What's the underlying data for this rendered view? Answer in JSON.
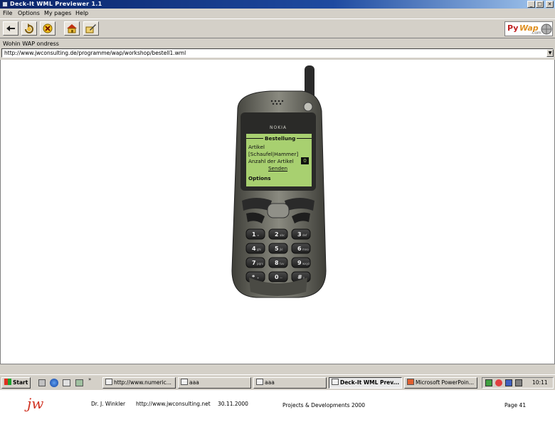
{
  "window": {
    "title": "Deck-It WML Previewer 1.1",
    "caption_buttons": [
      "_",
      "□",
      "✕"
    ]
  },
  "menu": [
    "File",
    "Options",
    "My pages",
    "Help"
  ],
  "toolbar": {
    "buttons": [
      {
        "name": "back-button",
        "icon": "back-arrow-icon"
      },
      {
        "name": "reload-button",
        "icon": "reload-icon"
      },
      {
        "name": "stop-button",
        "icon": "stop-icon"
      },
      {
        "name": "home-button",
        "icon": "home-icon"
      },
      {
        "name": "bookmark-button",
        "icon": "edit-bookmark-icon"
      }
    ],
    "logo": {
      "py": "Py",
      "wap": "Wap",
      "com": ".com"
    }
  },
  "address": {
    "label": "Wohin WAP ondress",
    "value": "http://www.jwconsulting.de/programme/wap/workshop/bestell1.wml"
  },
  "phone": {
    "brand": "NOKIA",
    "screen": {
      "title": "Bestellung",
      "lines": [
        "Artikel",
        "[Schaufel|Hammer]",
        "Anzahl der Artikel"
      ],
      "input_value": "0",
      "link": "Senden",
      "softkey": "Options"
    },
    "keys": [
      [
        "1",
        "2",
        "3"
      ],
      [
        "4",
        "5",
        "6"
      ],
      [
        "7",
        "8",
        "9"
      ],
      [
        "*",
        "0",
        "#"
      ]
    ],
    "key_sub": [
      [
        "∞",
        "abc",
        "def"
      ],
      [
        "ghi",
        "jkl",
        "mno"
      ],
      [
        "pqrs",
        "tuv",
        "wxyz"
      ],
      [
        "+",
        "—",
        "⇧"
      ]
    ]
  },
  "taskbar": {
    "start": "Start",
    "tasks": [
      {
        "label": "http://www.numeric...",
        "active": false
      },
      {
        "label": "aaa",
        "active": false
      },
      {
        "label": "aaa",
        "active": false
      },
      {
        "label": "Deck-It WML Prev...",
        "active": true
      },
      {
        "label": "Microsoft PowerPoin...",
        "active": false
      }
    ],
    "clock": "10:11"
  },
  "footer": {
    "logo": "jw",
    "author": "Dr. J. Winkler",
    "url": "http://www.jwconsulting.net",
    "date": "30.11.2000",
    "section": "Projects & Developments 2000",
    "page": "Page 41"
  },
  "colors": {
    "titlebar": "#0a246a",
    "chrome": "#d4d0c8",
    "lcd": "#a8d070",
    "phone_body": "#6a6a62",
    "logo_red": "#d03020"
  }
}
